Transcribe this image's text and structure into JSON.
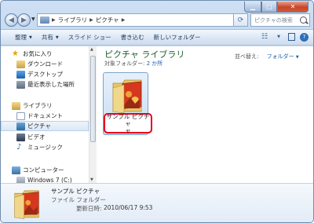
{
  "address": {
    "crumbs": [
      "ライブラリ",
      "ピクチャ"
    ],
    "search_placeholder": "ピクチャの検索"
  },
  "toolbar": {
    "items": [
      {
        "label": "整理",
        "dropdown": true
      },
      {
        "label": "共有",
        "dropdown": true
      },
      {
        "label": "スライド ショー",
        "dropdown": false
      },
      {
        "label": "書き込む",
        "dropdown": false
      },
      {
        "label": "新しいフォルダー",
        "dropdown": false
      }
    ]
  },
  "nav": {
    "items": [
      {
        "label": "お気に入り",
        "icon": "star-icon",
        "level": 0
      },
      {
        "label": "ダウンロード",
        "icon": "download-folder-icon",
        "level": 1
      },
      {
        "label": "デスクトップ",
        "icon": "desktop-icon",
        "level": 1
      },
      {
        "label": "最近表示した場所",
        "icon": "recent-places-icon",
        "level": 1
      },
      {
        "label": "ライブラリ",
        "icon": "library-icon",
        "level": 0
      },
      {
        "label": "ドキュメント",
        "icon": "documents-icon",
        "level": 1
      },
      {
        "label": "ピクチャ",
        "icon": "pictures-icon",
        "level": 1,
        "selected": true
      },
      {
        "label": "ビデオ",
        "icon": "videos-icon",
        "level": 1
      },
      {
        "label": "ミュージック",
        "icon": "music-icon",
        "level": 1
      },
      {
        "label": "コンピューター",
        "icon": "computer-icon",
        "level": 0
      },
      {
        "label": "Windows 7 (C:)",
        "icon": "drive-icon",
        "level": 1
      }
    ]
  },
  "content": {
    "title": "ピクチャ ライブラリ",
    "target_label": "対象フォルダー:",
    "target_count": "2 か所",
    "arrange_label": "並べ替え:",
    "arrange_value": "フォルダー",
    "folder": {
      "name_line1": "サンプル ピクチャ",
      "name_line2": "ャ"
    }
  },
  "details": {
    "name": "サンプル ピクチャ",
    "type": "ファイル フォルダー",
    "modified_label": "更新日時:",
    "modified_value": "2010/06/17 9:53"
  },
  "colors": {
    "title_green": "#1e5e2e",
    "link_blue": "#1a5fb4",
    "highlight_red": "#e8001c"
  }
}
